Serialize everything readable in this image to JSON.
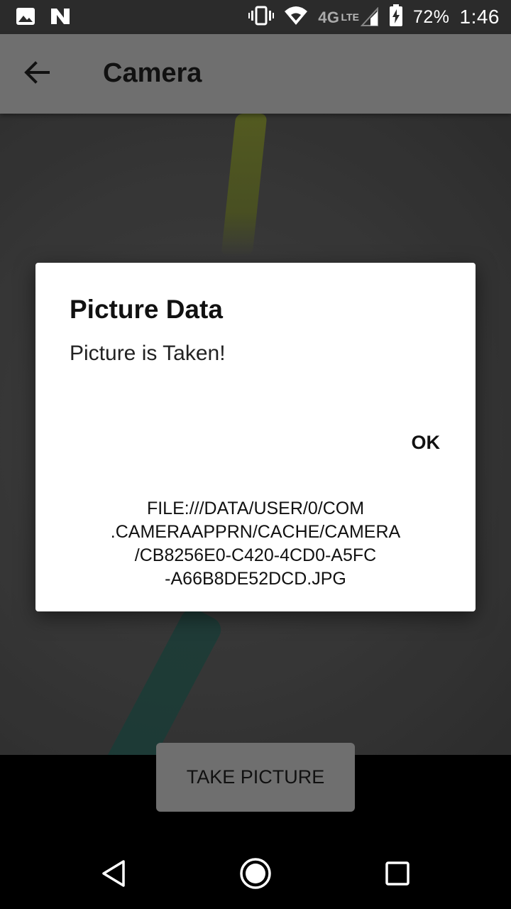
{
  "status_bar": {
    "left_icons": [
      "image-notification-icon",
      "n-notification-icon"
    ],
    "right_icons": [
      "vibrate-icon",
      "wifi-icon",
      "lte-signal-icon",
      "battery-charging-icon"
    ],
    "network_label": "4G",
    "lte_label": "LTE",
    "battery_percent": "72%",
    "time": "1:46"
  },
  "app_bar": {
    "title": "Camera",
    "back_icon": "arrow-back-icon"
  },
  "dialog": {
    "title": "Picture Data",
    "message": "Picture is Taken!",
    "ok_label": "OK",
    "uri_lines": [
      "FILE:///DATA/USER/0/COM",
      ".CAMERAAPPRN/CACHE/CAMERA",
      "/CB8256E0-C420-4CD0-A5FC",
      "-A66B8DE52DCD.JPG"
    ]
  },
  "take_picture": {
    "label": "TAKE PICTURE"
  },
  "nav_bar": {
    "back_icon": "triangle-back-icon",
    "home_icon": "circle-home-icon",
    "recents_icon": "square-recents-icon"
  },
  "colors": {
    "status_bar": "#2b2b2b",
    "app_bar": "#6f6f6f",
    "dialog_bg": "#ffffff",
    "button_bg": "#6f6f6f"
  }
}
